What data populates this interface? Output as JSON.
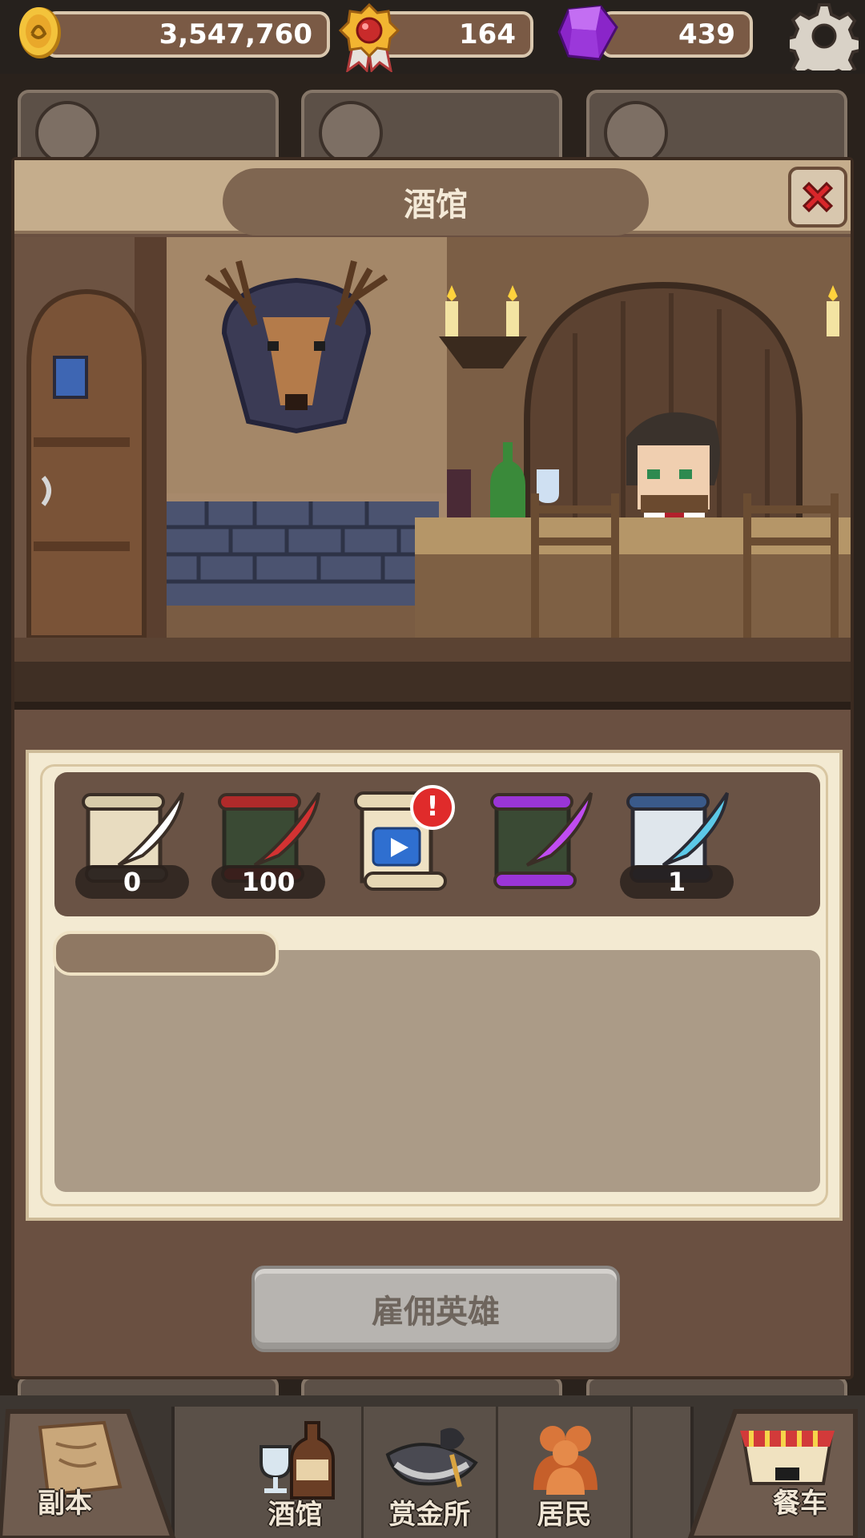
{
  "currency": {
    "gold": "3,547,760",
    "medals": "164",
    "gems": "439"
  },
  "panel": {
    "title": "酒馆"
  },
  "scrolls": [
    {
      "icon": "white-quill-scroll-icon",
      "count": "0"
    },
    {
      "icon": "red-quill-scroll-icon",
      "count": "100"
    },
    {
      "icon": "video-ad-scroll-icon",
      "count": "",
      "alert": "!"
    },
    {
      "icon": "purple-quill-scroll-icon",
      "count": ""
    },
    {
      "icon": "blue-quill-scroll-icon",
      "count": "1"
    }
  ],
  "hire_button": "雇佣英雄",
  "nav": {
    "dungeon": "副本",
    "tavern": "酒馆",
    "bounty": "赏金所",
    "residents": "居民",
    "food_cart": "餐车"
  },
  "colors": {
    "alert": "#e02b2b",
    "panel": "#6a5041",
    "paper": "#f3ead2"
  }
}
